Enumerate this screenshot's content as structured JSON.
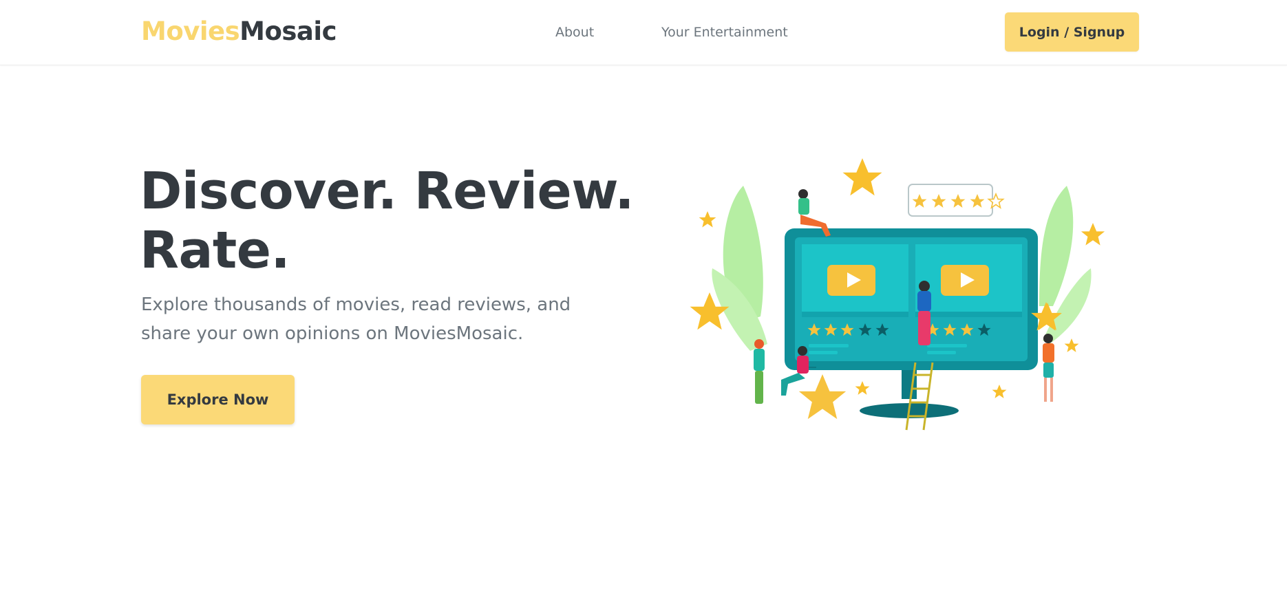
{
  "header": {
    "brand_part1": "Movies",
    "brand_part2": "Mosaic",
    "nav": [
      {
        "label": "About"
      },
      {
        "label": "Your Entertainment"
      }
    ],
    "login_label": "Login / Signup"
  },
  "hero": {
    "title": "Discover. Review. Rate.",
    "subtitle": "Explore thousands of movies, read reviews, and share your own opinions on MoviesMosaic.",
    "cta_label": "Explore Now"
  },
  "illustration": {
    "name": "movie-rating-illustration",
    "rating_stars_filled": 4,
    "rating_stars_total": 5
  },
  "colors": {
    "accent": "#fbd977",
    "brand_highlight": "#f9d66f",
    "text_dark": "#343a40",
    "text_muted": "#6c757d",
    "screen_teal": "#0f8f99",
    "leaf_green": "#b6eea3",
    "star_gold": "#f8bf2d"
  }
}
